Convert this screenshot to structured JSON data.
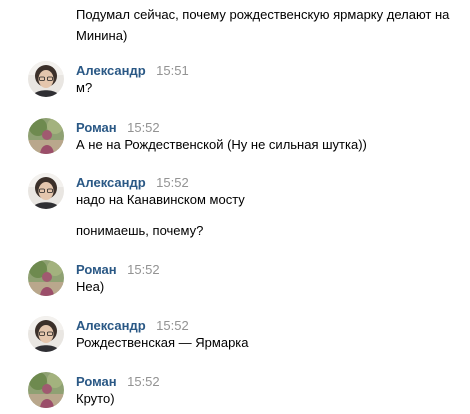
{
  "intro_text": "Подумал сейчас, почему рождественскую ярмарку делают на Минина)",
  "messages": [
    {
      "author": "Александр",
      "time": "15:51",
      "avatar": "alexander-avatar",
      "lines": [
        "м?"
      ]
    },
    {
      "author": "Роман",
      "time": "15:52",
      "avatar": "roman-avatar",
      "lines": [
        "А не на Рождественской (Ну не сильная шутка))"
      ]
    },
    {
      "author": "Александр",
      "time": "15:52",
      "avatar": "alexander-avatar",
      "lines": [
        "надо на Канавинском мосту",
        "понимаешь, почему?"
      ]
    },
    {
      "author": "Роман",
      "time": "15:52",
      "avatar": "roman-avatar",
      "lines": [
        "Неа)"
      ]
    },
    {
      "author": "Александр",
      "time": "15:52",
      "avatar": "alexander-avatar",
      "lines": [
        "Рождественская — Ярмарка"
      ]
    },
    {
      "author": "Роман",
      "time": "15:52",
      "avatar": "roman-avatar",
      "lines": [
        "Круто)"
      ]
    }
  ],
  "colors": {
    "author": "#2a5885",
    "time": "#939393",
    "text": "#000000",
    "background": "#ffffff"
  }
}
